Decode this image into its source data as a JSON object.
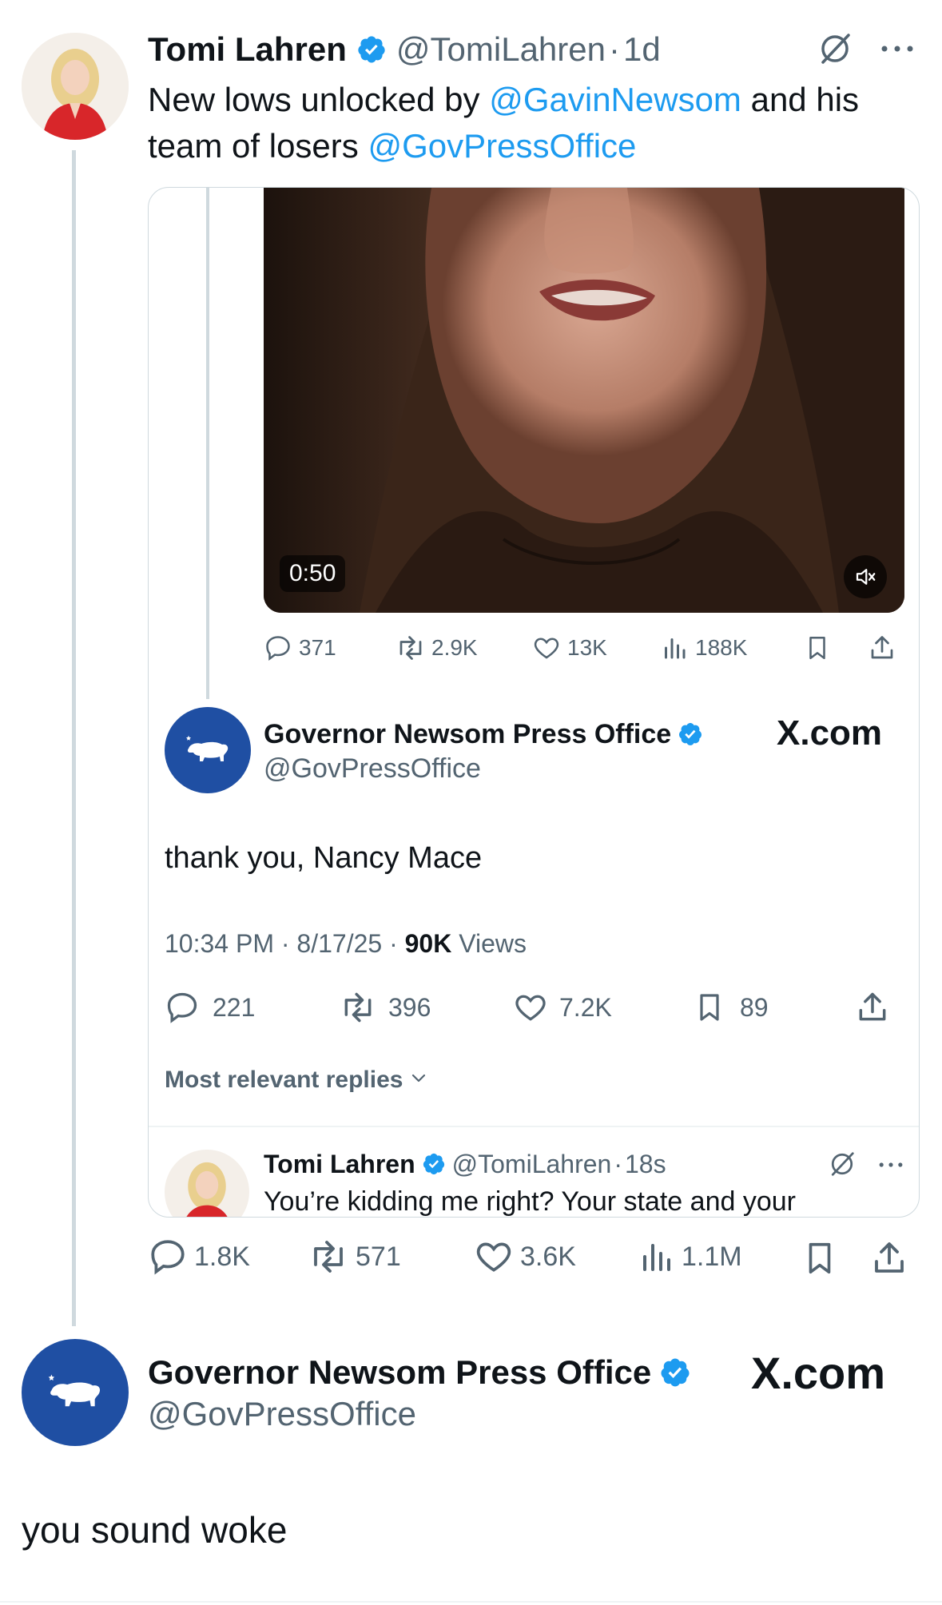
{
  "tweet": {
    "author_name": "Tomi Lahren",
    "handle": "@TomiLahren",
    "separator": "·",
    "time": "1d",
    "text_before": "New lows unlocked by ",
    "mention1": "@GavinNewsom",
    "text_middle": " and his team of losers ",
    "mention2": "@GovPressOffice",
    "stats": {
      "replies": "1.8K",
      "reposts": "571",
      "likes": "3.6K",
      "views": "1.1M"
    }
  },
  "quote": {
    "video": {
      "duration": "0:50",
      "mute_icon": "muted-speaker-icon"
    },
    "video_stats": {
      "replies": "371",
      "reposts": "2.9K",
      "likes": "13K",
      "views": "188K"
    },
    "author_name": "Governor Newsom Press Office",
    "handle": "@GovPressOffice",
    "brand": "X.com",
    "text": "thank you, Nancy Mace",
    "time": "10:34 PM",
    "date": "8/17/25",
    "views_count": "90K",
    "views_label": "Views",
    "sep": " · ",
    "stats": {
      "replies": "221",
      "reposts": "396",
      "likes": "7.2K",
      "bookmarks": "89"
    },
    "most_relevant": "Most relevant replies",
    "reply": {
      "author_name": "Tomi Lahren",
      "handle": "@TomiLahren",
      "separator": "·",
      "time": "18s",
      "text": "You’re kidding me right? Your state and your"
    }
  },
  "reply_tweet": {
    "author_name": "Governor Newsom Press Office",
    "handle": "@GovPressOffice",
    "brand": "X.com",
    "text": "you sound woke"
  },
  "colors": {
    "accent": "#1d9bf0",
    "gov_blue": "#1f4fa3",
    "text_gray": "#536471",
    "avatar_red": "#d8262a"
  }
}
